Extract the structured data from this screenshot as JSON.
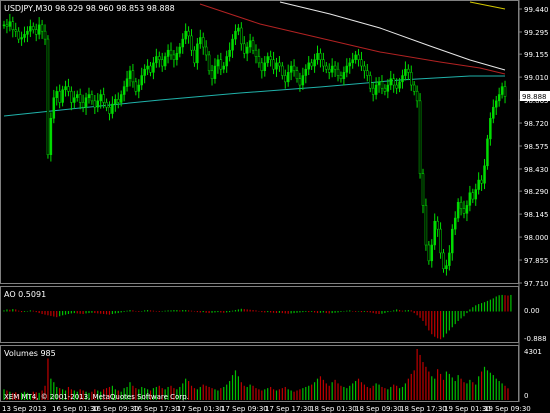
{
  "main": {
    "header": "USDJPY,M30  98.929 98.960 98.853 98.888",
    "price_levels": [
      "99.440",
      "99.295",
      "99.155",
      "99.010",
      "98.865",
      "98.720",
      "98.575",
      "98.430",
      "98.290",
      "98.145",
      "98.000",
      "97.855",
      "97.710"
    ],
    "current_price": "98.888",
    "colors": {
      "bull": "#00dd00",
      "bear": "#00dd00",
      "ma_white": "#e8e8e8",
      "ma_red": "#b22222",
      "ma_cyan": "#20b2aa",
      "ma_yellow": "#d4c800",
      "grid": "#2a2a2a",
      "price_tag_bg": "#ffffff"
    }
  },
  "ao": {
    "label": "AO 0.5091",
    "levels": [
      "0.00",
      "-0.888"
    ],
    "colors": {
      "up": "#00c000",
      "down": "#c00000"
    }
  },
  "volumes": {
    "label": "Volumes 985",
    "levels": [
      "4301",
      "0"
    ]
  },
  "footer": {
    "copyright": "XEM MT4, © 2001-2013, MetaQuotes Software Corp.",
    "time_labels": [
      "13 Sep 2013",
      "16 Sep 01:30",
      "16 Sep 09:30",
      "16 Sep 17:30",
      "17 Sep 01:30",
      "17 Sep 09:30",
      "17 Sep 17:30",
      "18 Sep 01:30",
      "18 Sep 09:30",
      "18 Sep 17:30",
      "19 Sep 01:30",
      "19 Sep 09:30"
    ]
  },
  "series": {
    "closes": [
      99.34,
      99.33,
      99.36,
      99.31,
      99.3,
      99.25,
      99.26,
      99.28,
      99.3,
      99.33,
      99.31,
      99.28,
      99.34,
      99.3,
      99.25,
      98.52,
      98.75,
      98.88,
      98.92,
      98.85,
      98.93,
      98.95,
      98.92,
      98.85,
      98.88,
      98.9,
      98.85,
      98.82,
      98.88,
      98.9,
      98.86,
      98.82,
      98.86,
      98.9,
      98.85,
      98.82,
      98.78,
      98.84,
      98.87,
      98.85,
      98.9,
      98.95,
      99.0,
      99.05,
      98.98,
      98.92,
      98.96,
      99.02,
      99.06,
      99.08,
      99.04,
      99.1,
      99.14,
      99.12,
      99.08,
      99.14,
      99.18,
      99.15,
      99.12,
      99.16,
      99.2,
      99.25,
      99.3,
      99.27,
      99.18,
      99.1,
      99.22,
      99.26,
      99.2,
      99.15,
      99.05,
      99.0,
      99.08,
      99.12,
      99.06,
      99.08,
      99.14,
      99.18,
      99.25,
      99.3,
      99.32,
      99.22,
      99.16,
      99.2,
      99.24,
      99.18,
      99.14,
      99.1,
      99.05,
      99.1,
      99.14,
      99.12,
      99.06,
      99.1,
      99.08,
      99.02,
      98.98,
      99.04,
      99.08,
      99.05,
      99.0,
      98.96,
      99.02,
      99.06,
      99.1,
      99.08,
      99.12,
      99.16,
      99.12,
      99.08,
      99.06,
      99.04,
      99.08,
      99.06,
      99.02,
      99.0,
      99.04,
      99.08,
      99.1,
      99.12,
      99.15,
      99.12,
      99.08,
      99.05,
      99.02,
      98.94,
      98.9,
      98.96,
      98.98,
      98.94,
      98.92,
      98.96,
      99.0,
      98.96,
      98.94,
      98.98,
      99.02,
      99.06,
      99.04,
      98.96,
      98.92,
      98.86,
      98.4,
      98.2,
      97.95,
      97.85,
      97.95,
      98.1,
      98.05,
      97.9,
      97.8,
      97.82,
      97.9,
      98.05,
      98.12,
      98.22,
      98.18,
      98.15,
      98.2,
      98.28,
      98.24,
      98.3,
      98.36,
      98.34,
      98.45,
      98.62,
      98.75,
      98.82,
      98.86,
      98.9,
      98.95,
      98.888
    ],
    "ao": [
      0.02,
      0.05,
      0.04,
      0.06,
      0.05,
      0.01,
      -0.02,
      -0.01,
      0.0,
      0.02,
      0.01,
      -0.02,
      -0.05,
      -0.08,
      -0.1,
      -0.12,
      -0.14,
      -0.16,
      -0.18,
      -0.15,
      -0.12,
      -0.1,
      -0.08,
      -0.06,
      -0.05,
      -0.06,
      -0.07,
      -0.08,
      -0.06,
      -0.05,
      -0.04,
      -0.05,
      -0.06,
      -0.07,
      -0.08,
      -0.09,
      -0.1,
      -0.08,
      -0.06,
      -0.05,
      -0.03,
      -0.01,
      0.01,
      0.03,
      0.02,
      0.0,
      -0.01,
      0.0,
      0.02,
      0.03,
      0.02,
      0.01,
      0.0,
      -0.01,
      0.0,
      0.01,
      0.02,
      0.02,
      0.03,
      0.03,
      0.02,
      0.03,
      0.03,
      0.02,
      0.01,
      0.0,
      -0.02,
      -0.03,
      -0.02,
      -0.04,
      -0.05,
      -0.04,
      -0.03,
      -0.02,
      -0.03,
      -0.04,
      -0.03,
      -0.02,
      0.01,
      0.03,
      0.05,
      0.07,
      0.06,
      0.05,
      0.04,
      0.03,
      0.02,
      0.0,
      -0.02,
      -0.03,
      -0.02,
      -0.03,
      -0.04,
      -0.05,
      -0.04,
      -0.05,
      -0.06,
      -0.07,
      -0.06,
      -0.05,
      -0.04,
      -0.03,
      -0.02,
      -0.01,
      -0.02,
      -0.01,
      -0.03,
      -0.05,
      -0.04,
      -0.03,
      -0.05,
      -0.06,
      -0.05,
      -0.04,
      -0.03,
      -0.01,
      0.0,
      0.01,
      0.02,
      0.0,
      -0.01,
      0.0,
      -0.02,
      -0.01,
      -0.02,
      -0.03,
      -0.05,
      -0.07,
      -0.08,
      -0.07,
      -0.05,
      -0.02,
      0.0,
      0.02,
      0.05,
      0.03,
      0.01,
      0.02,
      0.03,
      0.02,
      -0.05,
      -0.12,
      -0.2,
      -0.3,
      -0.45,
      -0.6,
      -0.72,
      -0.8,
      -0.85,
      -0.88,
      -0.82,
      -0.7,
      -0.6,
      -0.5,
      -0.4,
      -0.3,
      -0.22,
      -0.15,
      -0.05,
      0.05,
      0.12,
      0.18,
      0.22,
      0.25,
      0.28,
      0.32,
      0.36,
      0.4,
      0.46,
      0.5,
      0.51,
      0.5,
      0.49,
      0.5091
    ],
    "volumes": [
      900,
      800,
      700,
      600,
      650,
      500,
      600,
      700,
      600,
      500,
      700,
      650,
      600,
      800,
      1200,
      3500,
      1800,
      1500,
      1100,
      1000,
      900,
      800,
      1100,
      900,
      800,
      700,
      900,
      800,
      700,
      600,
      700,
      900,
      800,
      700,
      900,
      1000,
      1100,
      1200,
      900,
      800,
      700,
      1000,
      1100,
      1500,
      1200,
      1000,
      900,
      1100,
      1000,
      900,
      800,
      1000,
      1100,
      1200,
      1000,
      900,
      1100,
      1200,
      1000,
      900,
      1100,
      1400,
      1800,
      1600,
      1200,
      1000,
      900,
      1100,
      1300,
      1200,
      1100,
      1000,
      900,
      800,
      1000,
      1100,
      1300,
      1600,
      2100,
      2500,
      2000,
      1500,
      1200,
      1100,
      1300,
      1200,
      1000,
      900,
      800,
      900,
      1000,
      1100,
      900,
      800,
      900,
      1000,
      1100,
      900,
      800,
      700,
      800,
      900,
      1000,
      1100,
      1200,
      1300,
      1500,
      1800,
      2000,
      1700,
      1400,
      1200,
      1500,
      1700,
      1400,
      1200,
      1100,
      1000,
      1200,
      1400,
      1600,
      1800,
      1500,
      1300,
      1100,
      1000,
      1200,
      1400,
      1300,
      1100,
      1000,
      900,
      1100,
      1300,
      1200,
      1000,
      1100,
      1400,
      1800,
      2200,
      2500,
      4301,
      3800,
      3200,
      2800,
      2400,
      2000,
      1800,
      2600,
      2200,
      1700,
      2400,
      2200,
      1900,
      1600,
      2100,
      1800,
      1500,
      1400,
      1700,
      1500,
      1300,
      2000,
      2400,
      2800,
      2500,
      2300,
      2100,
      1800,
      1600,
      1400,
      1200,
      985
    ]
  }
}
